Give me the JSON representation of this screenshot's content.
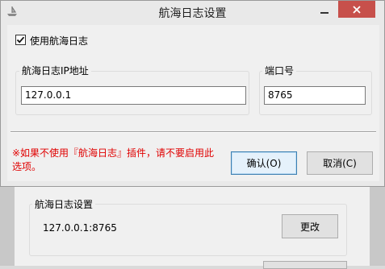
{
  "dialog": {
    "title": "航海日志设置",
    "use_log_label": "使用航海日志",
    "use_log_checked": true,
    "ip_group_label": "航海日志IP地址",
    "ip_value": "127.0.0.1",
    "port_group_label": "端口号",
    "port_value": "8765",
    "warning": "※如果不使用『航海日志』插件，请不要启用此选项。",
    "ok_label": "确认(O)",
    "cancel_label": "取消(C)"
  },
  "background": {
    "group_label": "航海日志设置",
    "address": "127.0.0.1:8765",
    "change_label": "更改"
  },
  "colors": {
    "close_button": "#c7504b",
    "warning_text": "#e00000",
    "default_button_border": "#3c7fb1"
  }
}
